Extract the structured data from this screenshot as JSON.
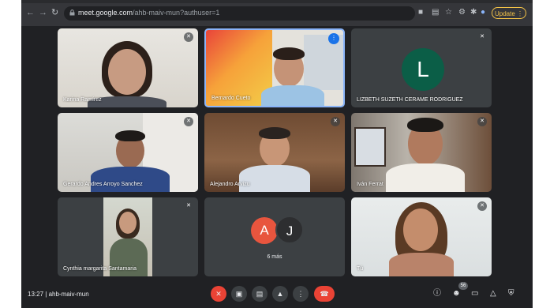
{
  "browser": {
    "url_host": "meet.google.com",
    "url_path": "/ahb-maiv-mun?authuser=1",
    "update_label": "Update",
    "back_icon": "arrow-left-icon",
    "forward_icon": "arrow-right-icon",
    "reload_icon": "reload-icon"
  },
  "participants": [
    {
      "name": "Karina Ramírez"
    },
    {
      "name": "Bernardo Cueto"
    },
    {
      "name": "LIZBETH SUZETH CERAME RODRIGUEZ",
      "initial": "L"
    },
    {
      "name": "Gerardo Andres Arroyo Sanchez"
    },
    {
      "name": "Alejandro Arvizu"
    },
    {
      "name": "Iván Ferrat"
    },
    {
      "name": "Cynthia margarita Santamaria"
    },
    {
      "name": "Tú"
    }
  ],
  "overflow_tile": {
    "avatar1": "A",
    "avatar2": "J",
    "label": "6 más"
  },
  "meeting": {
    "time": "13:27",
    "separator": "|",
    "code": "ahb-maiv-mun"
  },
  "people_count": "56",
  "colors": {
    "avatar_l": "#0b5e47",
    "avatar_a": "#e8553e",
    "accent_blue": "#1a73e8",
    "end_call": "#ea4335"
  }
}
